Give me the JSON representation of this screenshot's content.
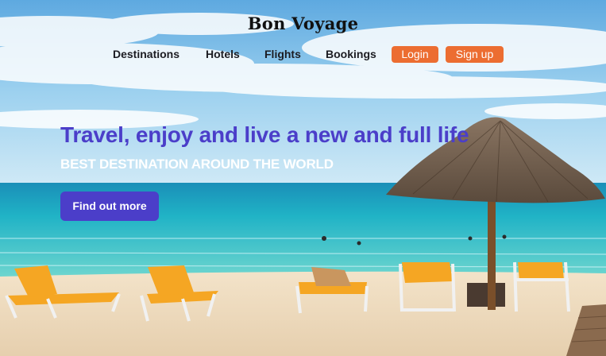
{
  "brand": {
    "name": "Bon Voyage"
  },
  "nav": {
    "links": [
      "Destinations",
      "Hotels",
      "Flights",
      "Bookings"
    ],
    "login_label": "Login",
    "signup_label": "Sign up"
  },
  "hero": {
    "headline": "Travel, enjoy and live a new and full life",
    "subheadline": "BEST DESTINATION AROUND THE WORLD",
    "cta_label": "Find out more"
  },
  "colors": {
    "accent_purple": "#4b3ec9",
    "accent_orange": "#ec6d31",
    "sky": "#7ec3ea",
    "sea": "#22b9c4",
    "sand": "#efdcc0"
  }
}
